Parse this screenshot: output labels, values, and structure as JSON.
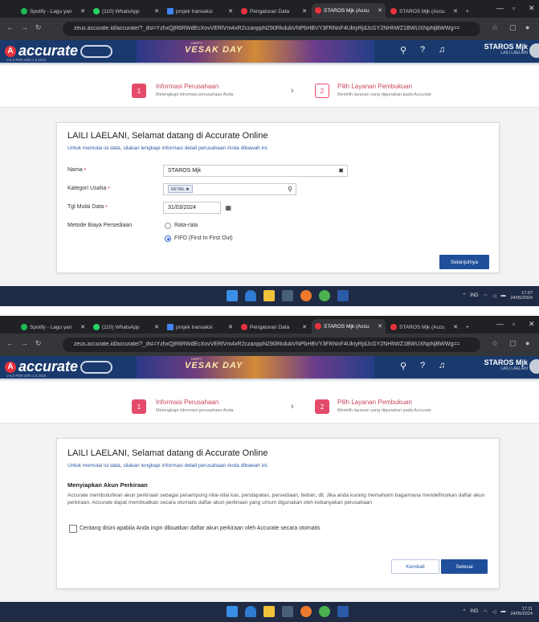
{
  "browser": {
    "tabs": [
      {
        "label": "Spotify - Lagu yan",
        "color": "#1db954"
      },
      {
        "label": "(110) WhatsApp",
        "color": "#25d366"
      },
      {
        "label": "projek transaksi",
        "color": "#4285f4"
      },
      {
        "label": "Pengaturan Data",
        "color": "#e8323c"
      },
      {
        "label": "STAROS Mjk (Accu",
        "color": "#e8323c"
      },
      {
        "label": "STAROS Mjk (Accu",
        "color": "#e8323c"
      }
    ],
    "url": "zeus.accurate.id/accurate/?_dsi=YzhxQjR6RWdEcXovVERlVm4xR2czanppN290RkdubVNPbHBVY3FRNnF4UktyRjdJcGY2NHhWZ1BWUXNpNjBWWg=="
  },
  "app": {
    "logo_text": "accurate",
    "logo_badge": "online",
    "version": "V.5.0 PER.SI/N 1.0 2024",
    "banner_small": "HAPPY",
    "banner_text": "VESAK DAY",
    "company": "STAROS Mjk",
    "user": "LAILI LAELANI"
  },
  "steps": {
    "step1_num": "1",
    "step1_title": "Informasi Perusahaan",
    "step1_desc": "Melengkapi informasi perusahaan Anda",
    "step2_num": "2",
    "step2_title": "Pilih Layanan Pembukuan",
    "step2_desc": "Memilih layanan yang digunakan pada Accurate"
  },
  "form1": {
    "title": "LAILI LAELANI, Selamat datang di Accurate Online",
    "subtitle": "Untuk memulai isi data, silakan lengkapi informasi detail perusahaan Anda dibawah ini.",
    "nama_label": "Nama",
    "nama_value": "STAROS Mjk",
    "kategori_label": "Kategori Usaha",
    "kategori_chip": "RETAIL",
    "tgl_label": "Tgl Mulai Data",
    "tgl_value": "31/03/2024",
    "metode_label": "Metode Biaya Persediaan",
    "option1": "Rata-rata",
    "option2": "FIFO (First In First Out)",
    "selected_option": "option2",
    "next_button": "Selanjutnya"
  },
  "form2": {
    "title": "LAILI LAELANI, Selamat datang di Accurate Online",
    "subtitle": "Untuk memulai isi data, silakan lengkapi informasi detail perusahaan Anda dibawah ini.",
    "section_title": "Menyiapkan Akun Perkiraan",
    "paragraph": "Accurate membutuhkan akun perkiraan sebagai penampung nilai-nilai kas, pendapatan, persediaan, beban, dll. Jika anda kurang memahami bagaimana mendefinisikan daftar akun perkiraan, Accurate dapat membuatkan secara otomatis daftar akun perkiraan yang umum digunakan oleh kebanyakan perusahaan",
    "checkbox_label": "Centang disini apabila Anda ingin dibuatkan daftar akun perkiraan oleh Accurate secara otomatis",
    "checkbox_checked": false,
    "back_button": "Kembali",
    "finish_button": "Selesai"
  },
  "taskbar": {
    "lang": "IND",
    "time1": "17.07",
    "date1": "24/05/2024",
    "time2": "17.11",
    "date2": "24/05/2024"
  }
}
